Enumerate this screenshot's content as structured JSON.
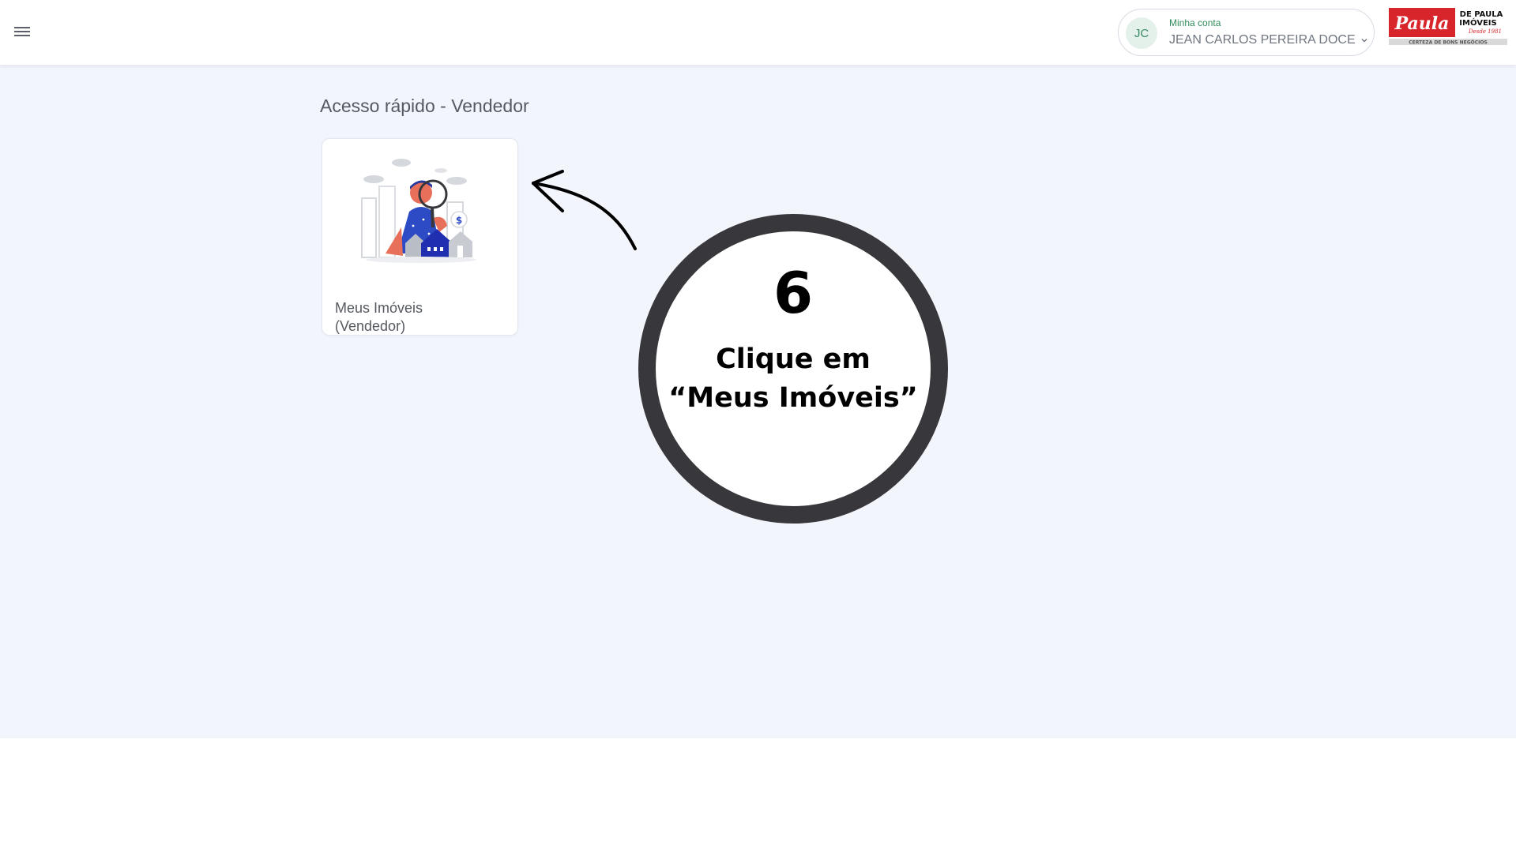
{
  "header": {
    "menu_icon": "hamburger-menu-icon",
    "account": {
      "initials": "JC",
      "label": "Minha conta",
      "name": "JEAN CARLOS PEREIRA DOCE",
      "chevron_icon": "chevron-down-icon"
    },
    "logo": {
      "brand": "Paula",
      "line1": "DE PAULA",
      "line2": "IMÓVEIS",
      "since": "Desde 1981",
      "tagline": "CERTEZA DE BONS NEGÓCIOS"
    }
  },
  "main": {
    "section_title": "Acesso rápido - Vendedor",
    "cards": [
      {
        "label_line1": "Meus Imóveis",
        "label_line2": "(Vendedor)",
        "icon": "person-searching-houses-illustration"
      }
    ]
  },
  "overlay": {
    "step_number": "6",
    "instruction_line1": "Clique em",
    "instruction_line2": "“Meus Imóveis”",
    "arrow_icon": "curved-arrow-icon"
  },
  "colors": {
    "background": "#f2f5fc",
    "account_label": "#2f8a5a",
    "avatar_bg": "#e3f1ea",
    "logo_red": "#d8252c",
    "circle_ring": "#38373b"
  }
}
